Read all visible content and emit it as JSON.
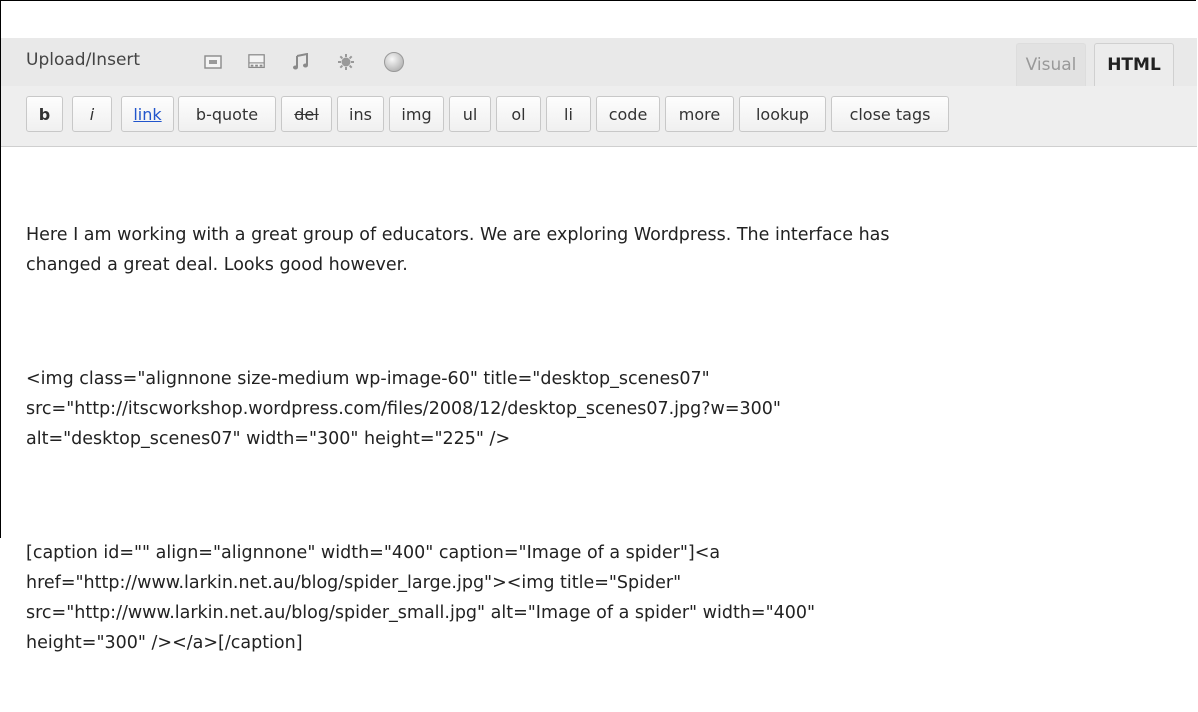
{
  "header": {
    "upload_label": "Upload/Insert",
    "media_icons": [
      "image-icon",
      "gallery-icon",
      "audio-icon",
      "media-icon",
      "circle-icon"
    ]
  },
  "tabs": {
    "visual": "Visual",
    "html": "HTML",
    "active": "HTML"
  },
  "toolbar": {
    "buttons": [
      "b",
      "i",
      "link",
      "b-quote",
      "del",
      "ins",
      "img",
      "ul",
      "ol",
      "li",
      "code",
      "more",
      "lookup",
      "close tags"
    ]
  },
  "editor": {
    "paragraphs": [
      "Here I am working with a great group of educators. We are exploring Wordpress. The interface has\nchanged a great deal. Looks good however.",
      "<img class=\"alignnone size-medium wp-image-60\" title=\"desktop_scenes07\"\nsrc=\"http://itscworkshop.wordpress.com/files/2008/12/desktop_scenes07.jpg?w=300\"\nalt=\"desktop_scenes07\" width=\"300\" height=\"225\" />",
      "[caption id=\"\" align=\"alignnone\" width=\"400\" caption=\"Image of a spider\"]<a\nhref=\"http://www.larkin.net.au/blog/spider_large.jpg\"><img title=\"Spider\"\nsrc=\"http://www.larkin.net.au/blog/spider_small.jpg\" alt=\"Image of a spider\" width=\"400\"\nheight=\"300\" /></a>[/caption]"
    ]
  }
}
